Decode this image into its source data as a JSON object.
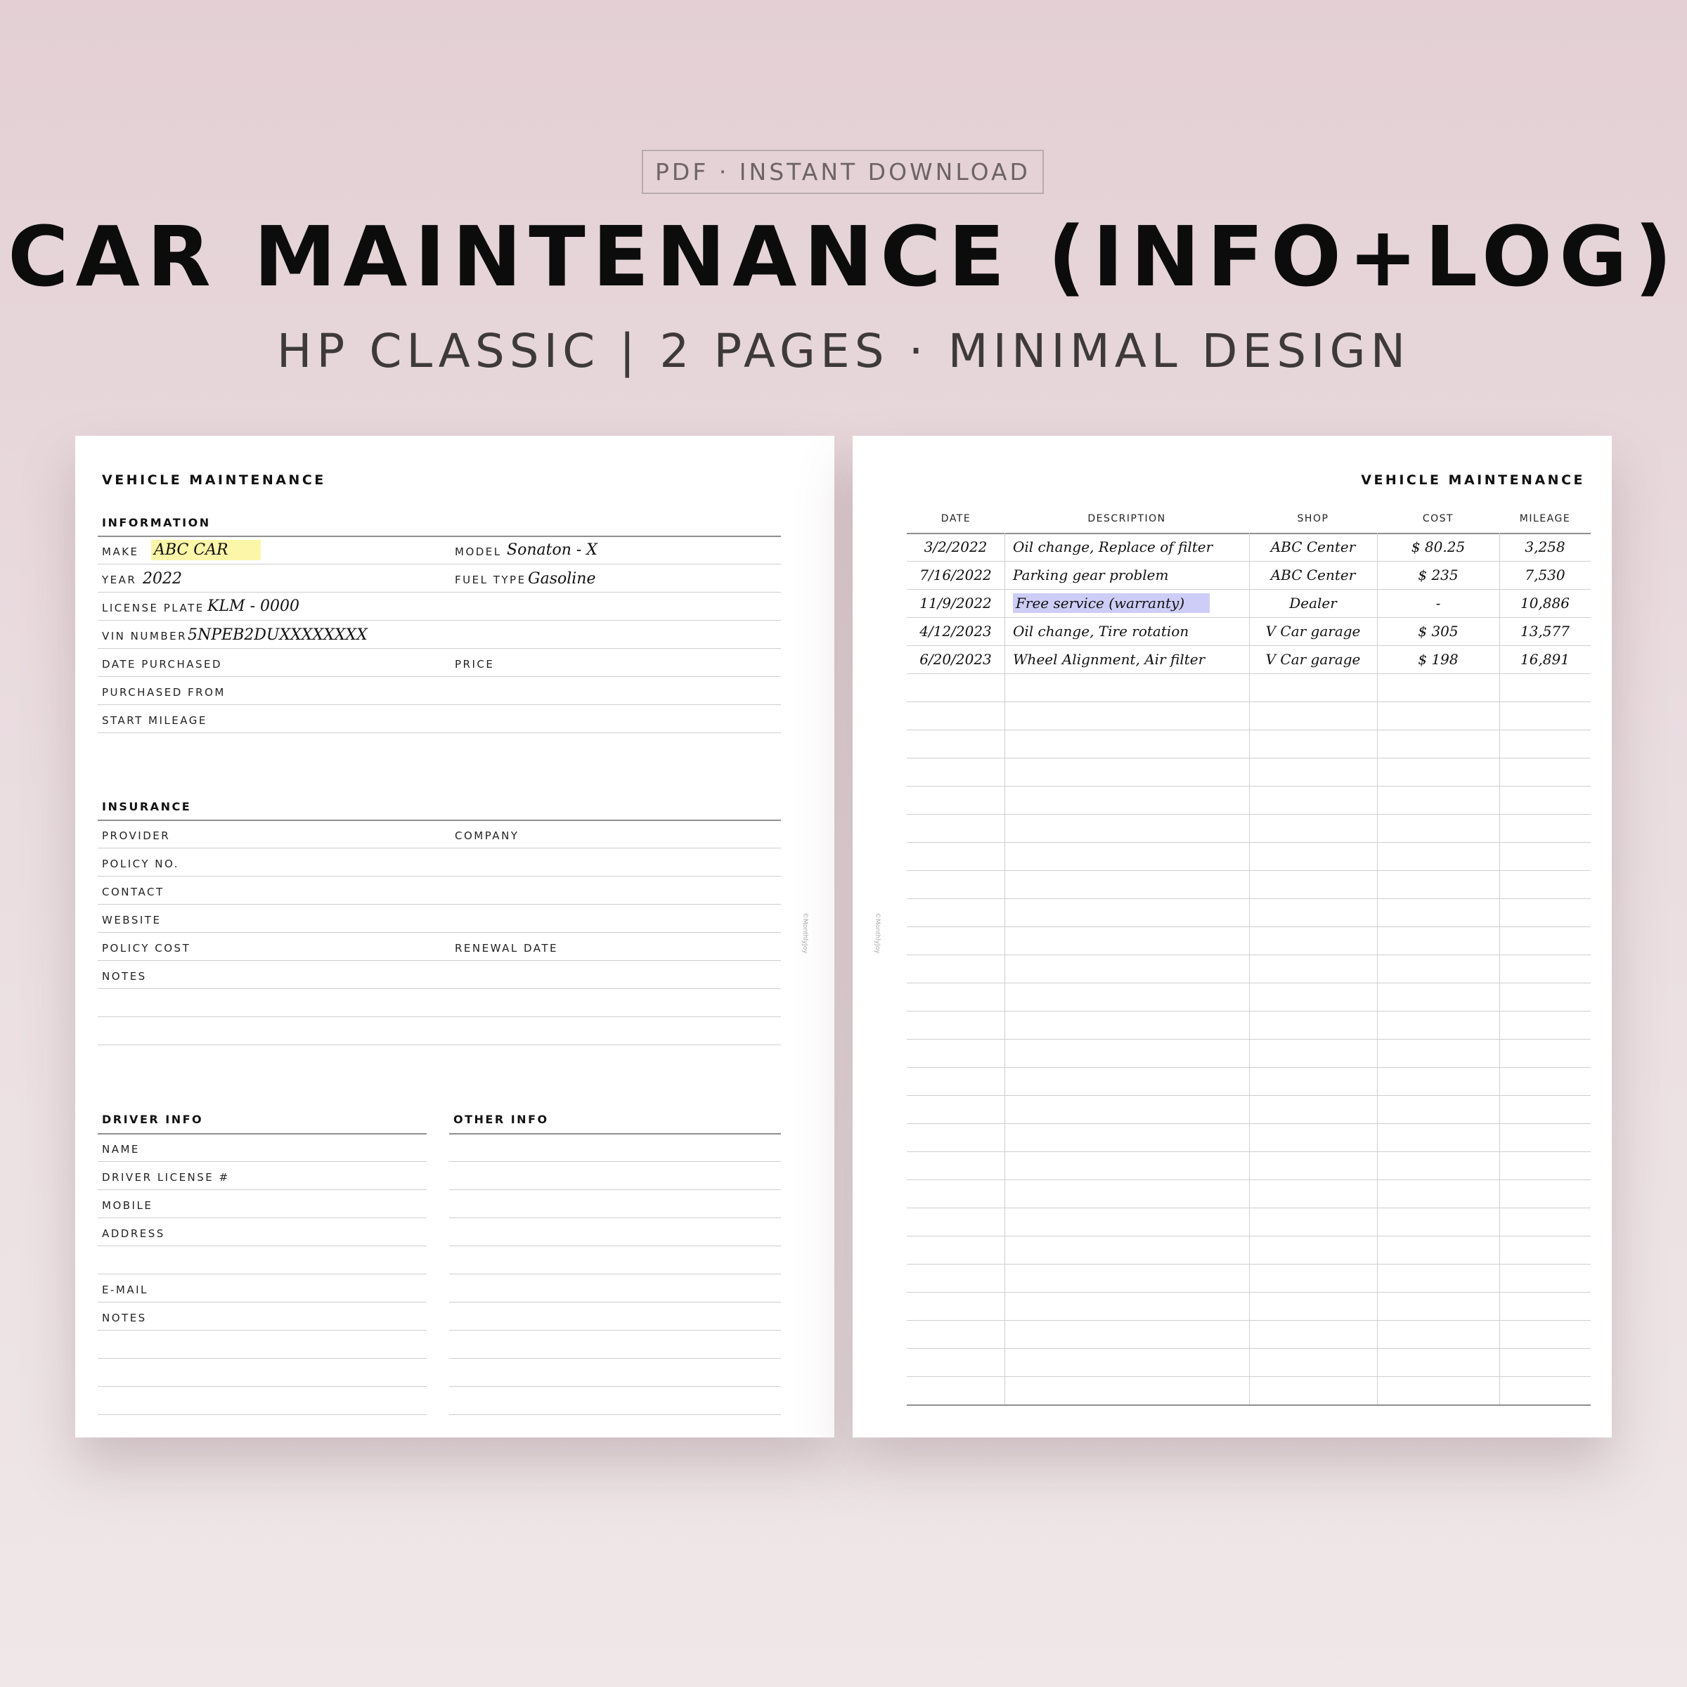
{
  "header": {
    "badge": "PDF · INSTANT DOWNLOAD",
    "title": "CAR MAINTENANCE (INFO+LOG)",
    "subtitle": "HP CLASSIC | 2 PAGES · MINIMAL DESIGN"
  },
  "left_page": {
    "title": "VEHICLE MAINTENANCE",
    "copyright": "©MonthlyJoy",
    "information": {
      "heading": "INFORMATION",
      "make_label": "MAKE",
      "make_value": "ABC CAR",
      "model_label": "MODEL",
      "model_value": "Sonaton - X",
      "year_label": "YEAR",
      "year_value": "2022",
      "fuel_label": "FUEL TYPE",
      "fuel_value": "Gasoline",
      "plate_label": "LICENSE PLATE",
      "plate_value": "KLM - 0000",
      "vin_label": "VIN NUMBER",
      "vin_value": "5NPEB2DUXXXXXXXX",
      "date_purchased_label": "DATE PURCHASED",
      "price_label": "PRICE",
      "purchased_from_label": "PURCHASED FROM",
      "start_mileage_label": "START MILEAGE"
    },
    "insurance": {
      "heading": "INSURANCE",
      "provider_label": "PROVIDER",
      "company_label": "COMPANY",
      "policy_no_label": "POLICY NO.",
      "contact_label": "CONTACT",
      "website_label": "WEBSITE",
      "policy_cost_label": "POLICY COST",
      "renewal_date_label": "RENEWAL DATE",
      "notes_label": "NOTES"
    },
    "driver": {
      "heading": "DRIVER INFO",
      "name_label": "NAME",
      "license_label": "DRIVER LICENSE #",
      "mobile_label": "MOBILE",
      "address_label": "ADDRESS",
      "email_label": "E-MAIL",
      "notes_label": "NOTES"
    },
    "other": {
      "heading": "OTHER INFO"
    }
  },
  "right_page": {
    "title": "VEHICLE MAINTENANCE",
    "copyright": "©MonthlyJoy",
    "columns": [
      "DATE",
      "DESCRIPTION",
      "SHOP",
      "COST",
      "MILEAGE"
    ],
    "rows": [
      {
        "date": "3/2/2022",
        "description": "Oil change, Replace of filter",
        "shop": "ABC Center",
        "cost": "$ 80.25",
        "mileage": "3,258"
      },
      {
        "date": "7/16/2022",
        "description": "Parking gear problem",
        "shop": "ABC Center",
        "cost": "$ 235",
        "mileage": "7,530"
      },
      {
        "date": "11/9/2022",
        "description": "Free service (warranty)",
        "shop": "Dealer",
        "cost": "-",
        "mileage": "10,886"
      },
      {
        "date": "4/12/2023",
        "description": "Oil change, Tire rotation",
        "shop": "V Car garage",
        "cost": "$ 305",
        "mileage": "13,577"
      },
      {
        "date": "6/20/2023",
        "description": "Wheel Alignment, Air filter",
        "shop": "V Car garage",
        "cost": "$ 198",
        "mileage": "16,891"
      }
    ]
  },
  "colors": {
    "highlight_yellow": "#fbf6a8",
    "highlight_purple": "#cdcdf7",
    "background": "#e3cfd4"
  }
}
